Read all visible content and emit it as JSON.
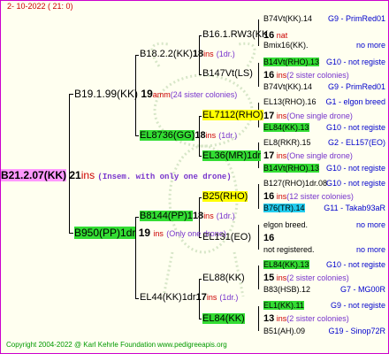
{
  "header": {
    "date": "2- 10-2022 ( 21: 0)"
  },
  "root": {
    "id": "B21.2.07(KK)",
    "num": "21",
    "ins": "ins",
    "note": "(Insem. with only one drone)"
  },
  "l1": [
    {
      "id": "B19.1.99(KK)",
      "num": "19",
      "ins": "amm",
      "note": "(24 sister colonies)"
    },
    {
      "id": "B950(PP)1dr",
      "num": "19",
      "ins": "ins",
      "note": "(Only one drone)"
    }
  ],
  "l2": [
    {
      "id": "B18.2.2(KK)",
      "num": "18",
      "ins": "ins",
      "note": "(1dr.)"
    },
    {
      "id": "EL8736(GG)",
      "num": "18",
      "ins": "ins",
      "note": "(1dr.)"
    },
    {
      "id": "B8144(PP)1",
      "num": "18",
      "ins": "ins",
      "note": "(1dr.)"
    },
    {
      "id": "EL44(KK)1dr",
      "num": "17",
      "ins": "ins",
      "note": "(1dr.)"
    }
  ],
  "l3": [
    {
      "id": "B16.1.RW3(KK",
      "num": "16",
      "ins": "nat",
      "note": ""
    },
    {
      "id": "B147Vt(LS)",
      "num": "",
      "ins": "",
      "note": ""
    },
    {
      "id": "EL7112(RHO)",
      "num": "17",
      "ins": "ins",
      "note": "(One single drone)"
    },
    {
      "id": "EL36(MR)1dr",
      "num": "",
      "ins": "",
      "note": ""
    },
    {
      "id": "B25(RHO)",
      "num": "",
      "ins": "",
      "note": ""
    },
    {
      "id": "EL131(EO)",
      "num": "",
      "ins": "",
      "note": ""
    },
    {
      "id": "EL88(KK)",
      "num": "",
      "ins": "",
      "note": ""
    },
    {
      "id": "EL84(KK)",
      "num": "",
      "ins": "",
      "note": ""
    }
  ],
  "l4": [
    {
      "id": "B74Vt(KK).14",
      "tail": "G9 - PrimRed01"
    },
    {
      "id": "Bmix16(KK).",
      "tail": "no more"
    },
    {
      "id": "B14Vt(RHO).13",
      "tail": "G10 - not registe"
    },
    {
      "id": "B74Vt(KK).14",
      "tail": "G9 - PrimRed01"
    },
    {
      "id": "EL13(RHO).16",
      "tail": "G1 - elgon breed"
    },
    {
      "id": "EL84(KK).13",
      "tail": "G10 - not registe"
    },
    {
      "id": "EL8(RKR).15",
      "tail": "G2 - EL157(EO)"
    },
    {
      "id": "B14Vt(RHO).13",
      "tail": "G10 - not registe"
    },
    {
      "id": "B127(RHO)1dr.08",
      "tail": "G10 - not registe"
    },
    {
      "id": "B76(TR).14",
      "tail": "G11 - Takab93aR"
    },
    {
      "id": "elgon breed.",
      "tail": "no more"
    },
    {
      "id": "not registered.",
      "tail": "no more"
    },
    {
      "id": "EL84(KK).13",
      "tail": "G10 - not registe"
    },
    {
      "id": "B83(HSB).12",
      "tail": "G7 - MG00R"
    },
    {
      "id": "EL1(KK).11",
      "tail": "G9 - not registe"
    },
    {
      "id": "B51(AH).09",
      "tail": "G19 - Sinop72R"
    }
  ],
  "l4mid": [
    {
      "num": "16",
      "ins": "ins",
      "note": "(2 sister colonies)"
    },
    {
      "num": "17",
      "ins": "ins",
      "note": "(One single drone)"
    },
    {
      "num": "17",
      "ins": "ins",
      "note": "(One single drone)"
    },
    {
      "num": "16",
      "ins": "ins",
      "note": "(12 sister colonies)"
    },
    {
      "num": "16",
      "ins": "",
      "note": "..."
    },
    {
      "num": "15",
      "ins": "ins",
      "note": "(2 sister colonies)"
    },
    {
      "num": "13",
      "ins": "ins",
      "note": "(2 sister colonies)"
    }
  ],
  "footer": {
    "copyright": "Copyright 2004-2022 @ Karl Kehrle Foundation",
    "site": "www.pedigreeapis.org"
  },
  "colors": {
    "accent": "#cc00cc",
    "highlight_green": "#33dd33",
    "highlight_yellow": "#ffff00",
    "highlight_cyan": "#22ccee",
    "root_bg": "#ff99ff"
  }
}
